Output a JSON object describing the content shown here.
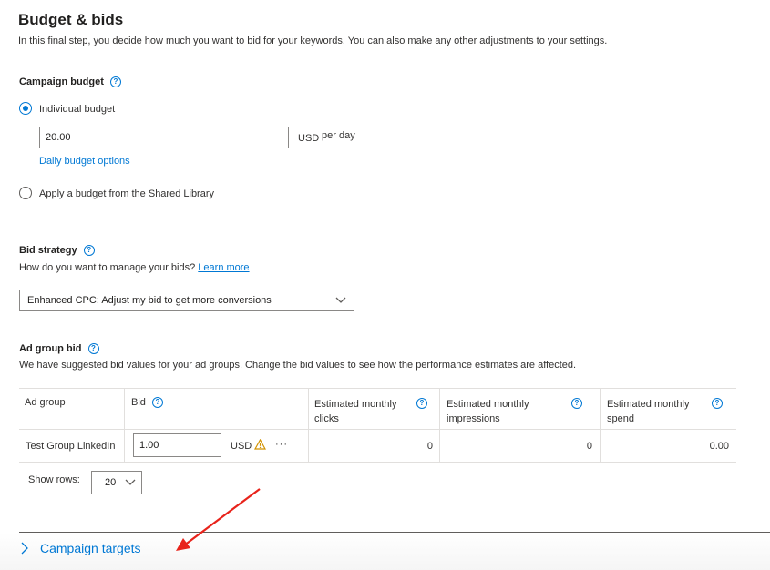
{
  "header": {
    "title": "Budget & bids",
    "description": "In this final step, you decide how much you want to bid for your keywords. You can also make any other adjustments to your settings."
  },
  "campaign_budget": {
    "label": "Campaign budget",
    "option_individual": "Individual budget",
    "budget_value": "20.00",
    "currency": "USD",
    "period": "per day",
    "daily_options_link": "Daily budget options",
    "option_shared": "Apply a budget from the Shared Library"
  },
  "bid_strategy": {
    "label": "Bid strategy",
    "question": "How do you want to manage your bids?",
    "learn_more": "Learn more",
    "selected": "Enhanced CPC: Adjust my bid to get more conversions"
  },
  "ad_group_bid": {
    "label": "Ad group bid",
    "description": "We have suggested bid values for your ad groups. Change the bid values to see how the performance estimates are affected.",
    "columns": {
      "ad_group": "Ad group",
      "bid": "Bid",
      "clicks": "Estimated monthly clicks",
      "impressions": "Estimated monthly impressions",
      "spend": "Estimated monthly spend"
    },
    "rows": [
      {
        "ad_group": "Test Group LinkedIn",
        "bid": "1.00",
        "currency": "USD",
        "more": "···",
        "clicks": "0",
        "impressions": "0",
        "spend": "0.00"
      }
    ],
    "show_rows_label": "Show rows:",
    "show_rows_value": "20"
  },
  "footer": {
    "campaign_targets": "Campaign targets"
  },
  "colors": {
    "accent": "#0078d4",
    "warning": "#d29200",
    "annotation_arrow": "#e8231b"
  }
}
